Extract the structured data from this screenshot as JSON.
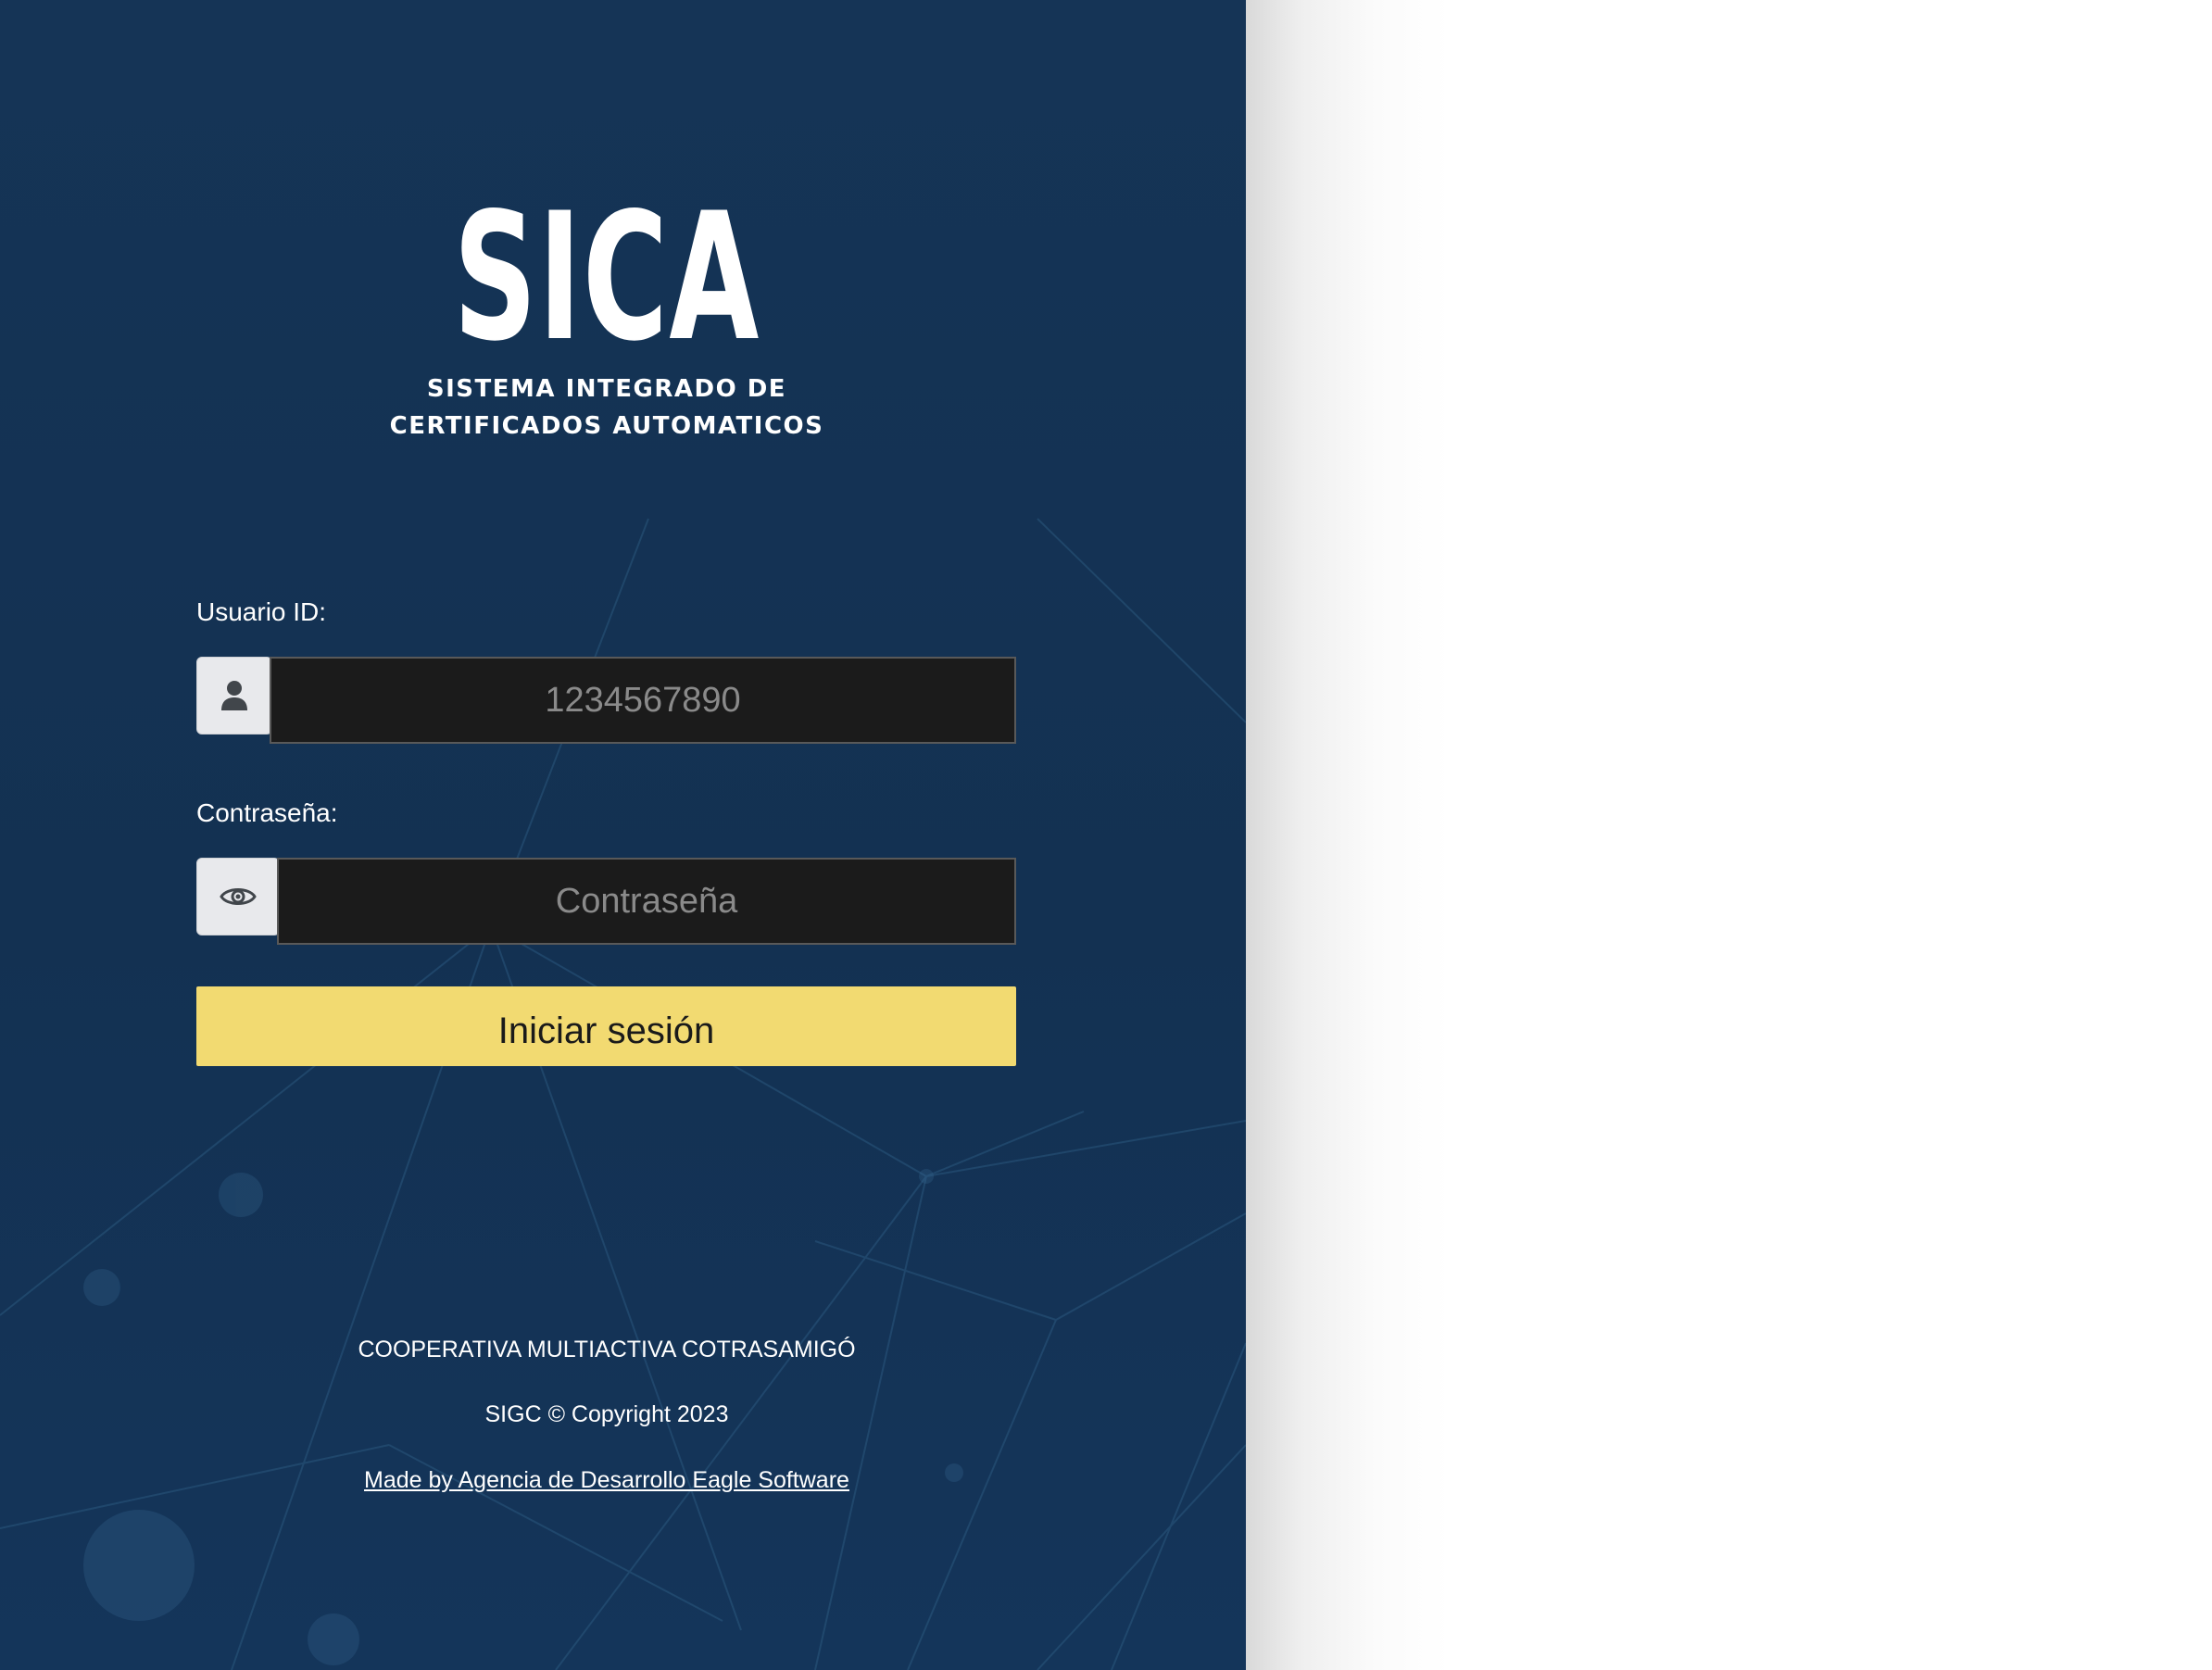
{
  "logo": {
    "mark": "SICA",
    "subtitle_line1": "SISTEMA INTEGRADO DE",
    "subtitle_line2": "CERTIFICADOS AUTOMATICOS"
  },
  "form": {
    "user_label": "Usuario ID:",
    "user_placeholder": "1234567890",
    "user_icon": "user-icon",
    "password_label": "Contraseña:",
    "password_placeholder": "Contraseña",
    "password_icon": "eye-icon",
    "submit_label": "Iniciar sesión"
  },
  "footer": {
    "organization": "COOPERATIVA MULTIACTIVA COTRASAMIGÓ",
    "copyright": "SIGC © Copyright 2023",
    "credit_link": "Made by Agencia de Desarrollo Eagle Software"
  },
  "colors": {
    "panel_background": "#153456",
    "button_background": "#f2da71",
    "input_background": "#1b1b1b"
  }
}
